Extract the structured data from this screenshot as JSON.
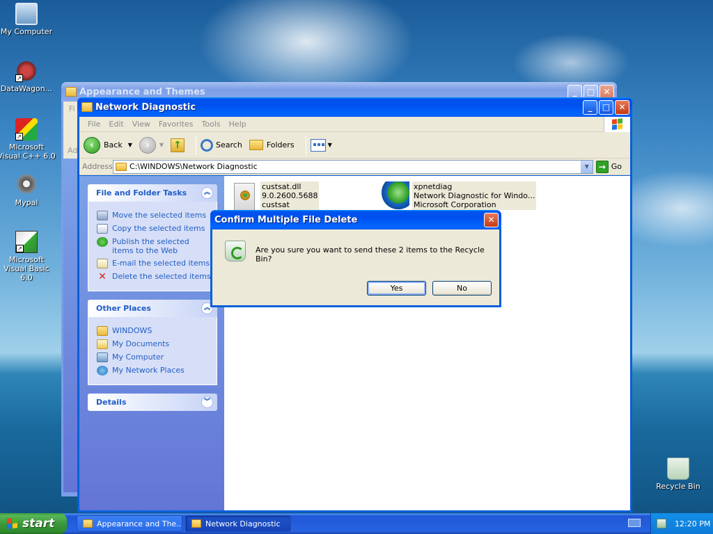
{
  "desktop": {
    "icons": [
      {
        "label": "My Computer"
      },
      {
        "label": "DataWagon..."
      },
      {
        "label": "Microsoft Visual C++ 6.0"
      },
      {
        "label": "Mypal"
      },
      {
        "label": "Microsoft Visual Basic 6.0"
      },
      {
        "label": "Recycle Bin"
      }
    ]
  },
  "back_window": {
    "title": "Appearance and Themes",
    "menu_fragment": "Fi",
    "address_fragment": "Ad"
  },
  "explorer": {
    "title": "Network Diagnostic",
    "menu": [
      "File",
      "Edit",
      "View",
      "Favorites",
      "Tools",
      "Help"
    ],
    "toolbar": {
      "back": "Back",
      "search": "Search",
      "folders": "Folders"
    },
    "address": {
      "label": "Address",
      "value": "C:\\WINDOWS\\Network Diagnostic",
      "go": "Go"
    },
    "file_tasks": {
      "title": "File and Folder Tasks",
      "items": [
        "Move the selected items",
        "Copy the selected items",
        "Publish the selected items to the Web",
        "E-mail the selected items",
        "Delete the selected items"
      ]
    },
    "other_places": {
      "title": "Other Places",
      "items": [
        "WINDOWS",
        "My Documents",
        "My Computer",
        "My Network Places"
      ]
    },
    "details": {
      "title": "Details"
    },
    "files": [
      {
        "name": "custsat.dll",
        "line2": "9.0.2600.5688",
        "line3": "custsat",
        "icon": "dll-gear-icon"
      },
      {
        "name": "xpnetdiag",
        "line2": "Network Diagnostic for Windo...",
        "line3": "Microsoft Corporation",
        "icon": "globe-network-icon"
      }
    ]
  },
  "dialog": {
    "title": "Confirm Multiple File Delete",
    "message": "Are you sure you want to send these 2 items to the Recycle Bin?",
    "yes": "Yes",
    "no": "No"
  },
  "taskbar": {
    "start": "start",
    "tasks": [
      "Appearance and The...",
      "Network Diagnostic"
    ],
    "clock": "12:20 PM"
  }
}
